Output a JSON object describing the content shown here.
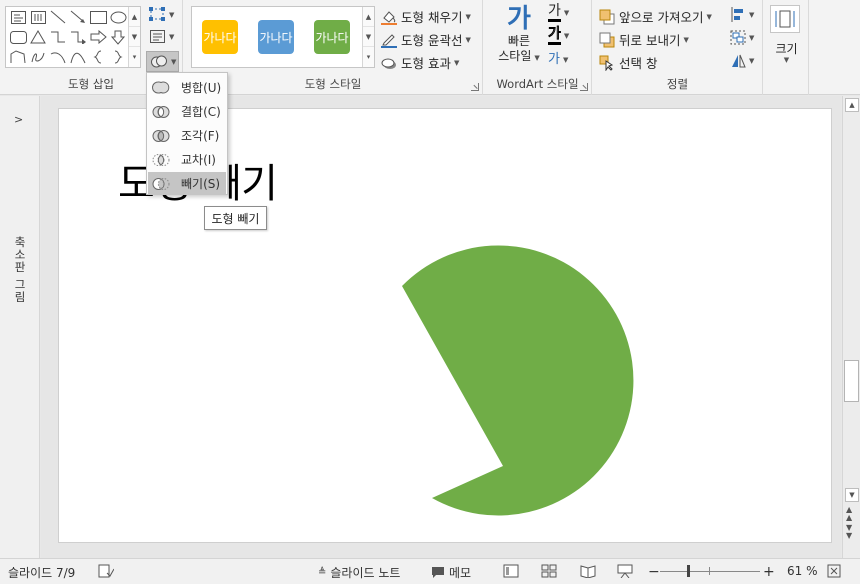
{
  "ribbon": {
    "insert_shapes": {
      "label": "도형 삽입"
    },
    "shape_styles": {
      "label": "도형 스타일",
      "swatches": [
        {
          "text": "가나다",
          "color": "#ffc000"
        },
        {
          "text": "가나다",
          "color": "#5b9bd5"
        },
        {
          "text": "가나다",
          "color": "#70ad47"
        }
      ],
      "fill": "도형 채우기",
      "outline": "도형 윤곽선",
      "effects": "도형 효과"
    },
    "wordart": {
      "label": "WordArt 스타일",
      "quick_styles_line1": "빠른",
      "quick_styles_line2": "스타일",
      "glyph": "가"
    },
    "arrange": {
      "label": "정렬",
      "bring_forward": "앞으로 가져오기",
      "send_backward": "뒤로 보내기",
      "selection_pane": "선택 창"
    },
    "size": {
      "label": "크기"
    }
  },
  "merge_menu": {
    "items": [
      {
        "label": "병합(U)"
      },
      {
        "label": "결합(C)"
      },
      {
        "label": "조각(F)"
      },
      {
        "label": "교차(I)"
      },
      {
        "label": "빼기(S)"
      }
    ],
    "selected_index": 4,
    "tooltip": "도형 빼기"
  },
  "thumbnail_pane": {
    "label": "축소판 그림"
  },
  "slide": {
    "title": "도형 빼기",
    "shape_color": "#70ad47"
  },
  "status": {
    "slide_counter": "슬라이드 7/9",
    "notes": "슬라이드 노트",
    "comments": "메모",
    "zoom": "61 %"
  }
}
